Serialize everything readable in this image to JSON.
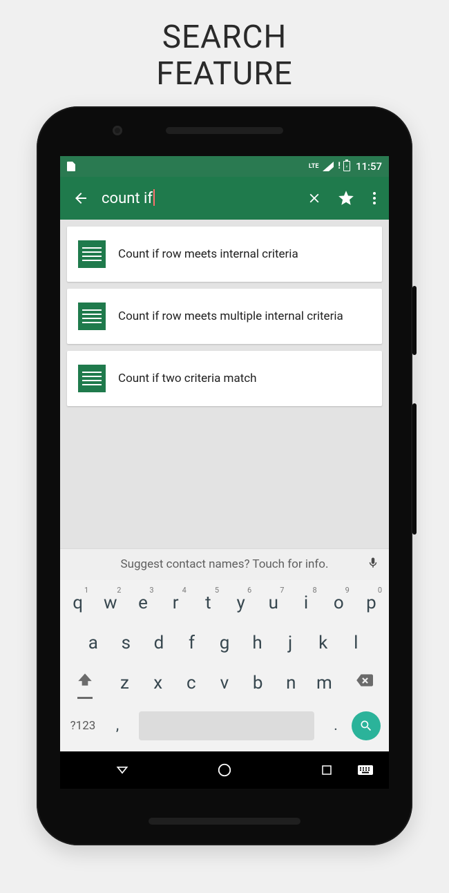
{
  "promo": {
    "line1": "SEARCH",
    "line2": "FEATURE"
  },
  "status": {
    "network_label": "LTE",
    "time": "11:57"
  },
  "appbar": {
    "search_value": "count if"
  },
  "results": [
    {
      "title": "Count if row meets internal criteria"
    },
    {
      "title": "Count if row meets multiple internal criteria"
    },
    {
      "title": "Count if two criteria match"
    }
  ],
  "keyboard": {
    "suggestion": "Suggest contact names? Touch for info.",
    "row1": [
      {
        "k": "q",
        "n": "1"
      },
      {
        "k": "w",
        "n": "2"
      },
      {
        "k": "e",
        "n": "3"
      },
      {
        "k": "r",
        "n": "4"
      },
      {
        "k": "t",
        "n": "5"
      },
      {
        "k": "y",
        "n": "6"
      },
      {
        "k": "u",
        "n": "7"
      },
      {
        "k": "i",
        "n": "8"
      },
      {
        "k": "o",
        "n": "9"
      },
      {
        "k": "p",
        "n": "0"
      }
    ],
    "row2": [
      "a",
      "s",
      "d",
      "f",
      "g",
      "h",
      "j",
      "k",
      "l"
    ],
    "row3": [
      "z",
      "x",
      "c",
      "v",
      "b",
      "n",
      "m"
    ],
    "symbols_label": "?123",
    "comma": ",",
    "period": "."
  }
}
